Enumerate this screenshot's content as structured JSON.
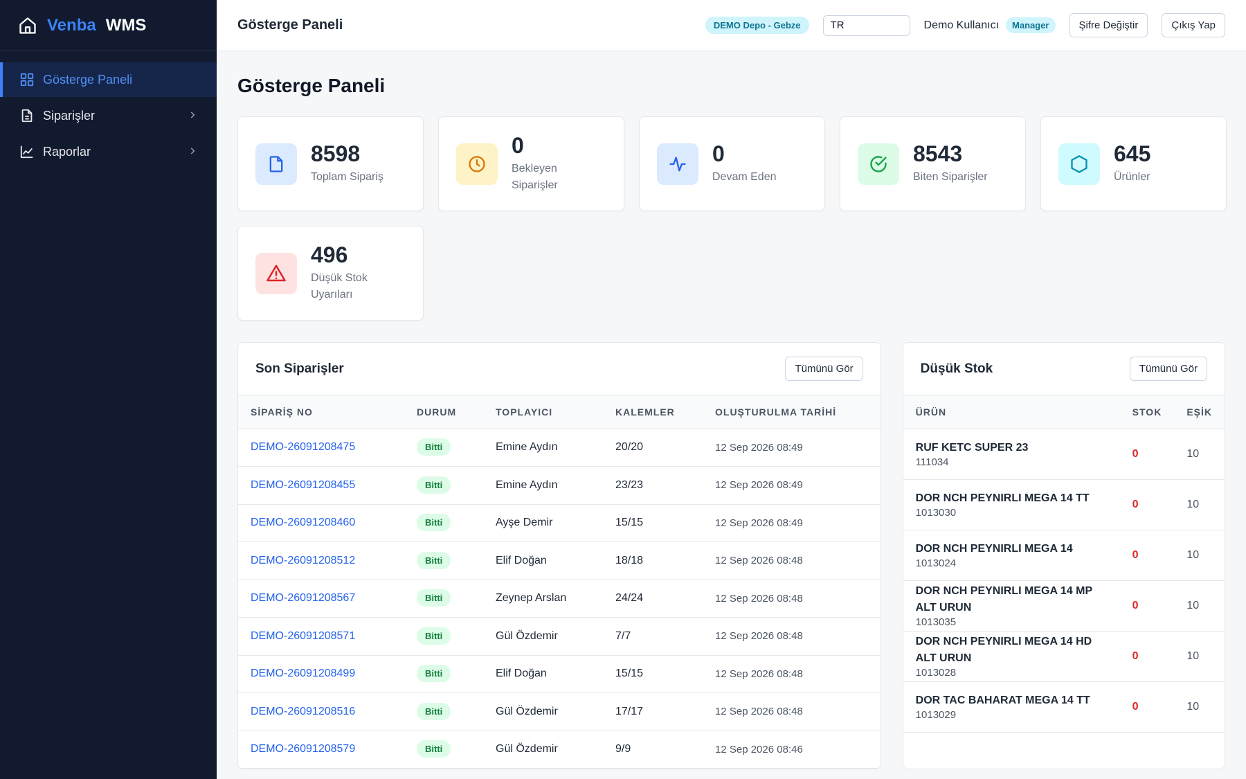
{
  "brand": {
    "part1": "Venba",
    "part2": "WMS"
  },
  "sidebar": {
    "items": [
      {
        "label": "Gösterge Paneli",
        "icon": "grid-icon",
        "active": true
      },
      {
        "label": "Siparişler",
        "icon": "document-icon",
        "active": false
      },
      {
        "label": "Raporlar",
        "icon": "line-chart-icon",
        "active": false
      }
    ]
  },
  "header": {
    "title": "Gösterge Paneli",
    "warehouse": "DEMO Depo - Gebze",
    "language": "TR",
    "user": "Demo Kullanıcı",
    "role": "Manager",
    "change_password": "Şifre Değiştir",
    "logout": "Çıkış Yap"
  },
  "page": {
    "title": "Gösterge Paneli"
  },
  "stats": [
    {
      "value": "8598",
      "label": "Toplam Sipariş",
      "icon": "file-icon",
      "bg": "#dbeafe",
      "color": "#2563eb"
    },
    {
      "value": "0",
      "label": "Bekleyen Siparişler",
      "icon": "clock-icon",
      "bg": "#fef3c7",
      "color": "#d97706"
    },
    {
      "value": "0",
      "label": "Devam Eden",
      "icon": "activity-icon",
      "bg": "#dbeafe",
      "color": "#2563eb"
    },
    {
      "value": "8543",
      "label": "Biten Siparişler",
      "icon": "check-circle-icon",
      "bg": "#dcfce7",
      "color": "#16a34a"
    },
    {
      "value": "645",
      "label": "Ürünler",
      "icon": "hexagon-icon",
      "bg": "#cffafe",
      "color": "#0891b2"
    },
    {
      "value": "496",
      "label": "Düşük Stok Uyarıları",
      "icon": "warning-icon",
      "bg": "#fee2e2",
      "color": "#dc2626"
    }
  ],
  "orders": {
    "title": "Son Siparişler",
    "view_all": "Tümünü Gör",
    "columns": [
      "SİPARİŞ NO",
      "DURUM",
      "TOPLAYICI",
      "KALEMLER",
      "OLUŞTURULMA TARİHİ"
    ],
    "rows": [
      {
        "no": "DEMO-26091208475",
        "status": "Bitti",
        "picker": "Emine Aydın",
        "items": "20/20",
        "date": "12 Sep 2026 08:49"
      },
      {
        "no": "DEMO-26091208455",
        "status": "Bitti",
        "picker": "Emine Aydın",
        "items": "23/23",
        "date": "12 Sep 2026 08:49"
      },
      {
        "no": "DEMO-26091208460",
        "status": "Bitti",
        "picker": "Ayşe Demir",
        "items": "15/15",
        "date": "12 Sep 2026 08:49"
      },
      {
        "no": "DEMO-26091208512",
        "status": "Bitti",
        "picker": "Elif Doğan",
        "items": "18/18",
        "date": "12 Sep 2026 08:48"
      },
      {
        "no": "DEMO-26091208567",
        "status": "Bitti",
        "picker": "Zeynep Arslan",
        "items": "24/24",
        "date": "12 Sep 2026 08:48"
      },
      {
        "no": "DEMO-26091208571",
        "status": "Bitti",
        "picker": "Gül Özdemir",
        "items": "7/7",
        "date": "12 Sep 2026 08:48"
      },
      {
        "no": "DEMO-26091208499",
        "status": "Bitti",
        "picker": "Elif Doğan",
        "items": "15/15",
        "date": "12 Sep 2026 08:48"
      },
      {
        "no": "DEMO-26091208516",
        "status": "Bitti",
        "picker": "Gül Özdemir",
        "items": "17/17",
        "date": "12 Sep 2026 08:48"
      },
      {
        "no": "DEMO-26091208579",
        "status": "Bitti",
        "picker": "Gül Özdemir",
        "items": "9/9",
        "date": "12 Sep 2026 08:46"
      }
    ]
  },
  "low_stock": {
    "title": "Düşük Stok",
    "view_all": "Tümünü Gör",
    "columns": [
      "ÜRÜN",
      "STOK",
      "EŞİK"
    ],
    "rows": [
      {
        "name": "RUF KETC SUPER 23",
        "code": "111034",
        "stock": "0",
        "threshold": "10"
      },
      {
        "name": "DOR NCH PEYNIRLI MEGA 14 TT",
        "code": "1013030",
        "stock": "0",
        "threshold": "10"
      },
      {
        "name": "DOR NCH PEYNIRLI MEGA 14",
        "code": "1013024",
        "stock": "0",
        "threshold": "10"
      },
      {
        "name": "DOR NCH PEYNIRLI MEGA 14 MP ALT URUN",
        "code": "1013035",
        "stock": "0",
        "threshold": "10"
      },
      {
        "name": "DOR NCH PEYNIRLI MEGA 14 HD ALT URUN",
        "code": "1013028",
        "stock": "0",
        "threshold": "10"
      },
      {
        "name": "DOR TAC BAHARAT MEGA 14 TT",
        "code": "1013029",
        "stock": "0",
        "threshold": "10"
      }
    ]
  }
}
